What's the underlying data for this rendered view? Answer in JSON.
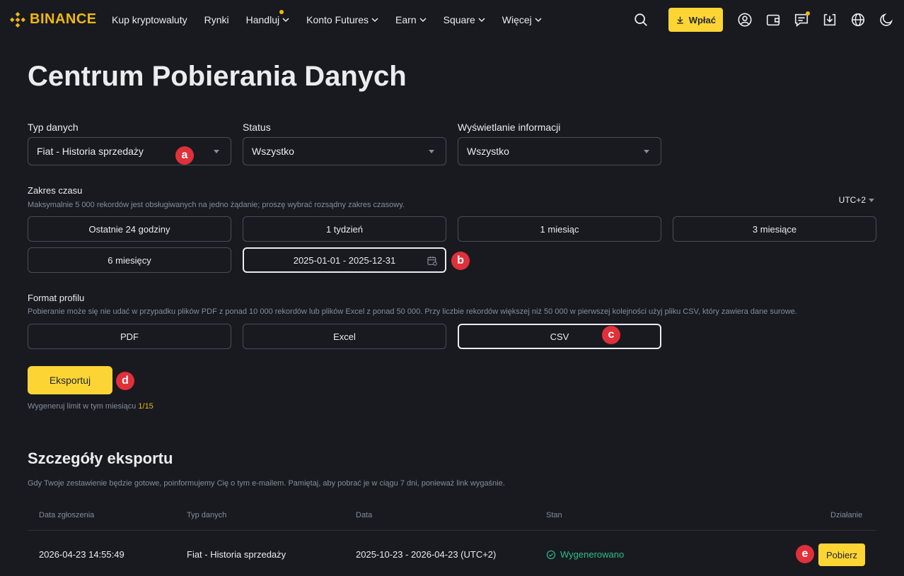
{
  "brand": {
    "name": "BINANCE",
    "color": "#f0b90b"
  },
  "nav": {
    "items": [
      {
        "label": "Kup kryptowaluty",
        "dropdown": false
      },
      {
        "label": "Rynki",
        "dropdown": false
      },
      {
        "label": "Handluj",
        "dropdown": true,
        "dot": true
      },
      {
        "label": "Konto Futures",
        "dropdown": true
      },
      {
        "label": "Earn",
        "dropdown": true
      },
      {
        "label": "Square",
        "dropdown": true
      },
      {
        "label": "Więcej",
        "dropdown": true
      }
    ],
    "deposit_label": "Wpłać",
    "icons": [
      "search-icon",
      "download-icon",
      "user-icon",
      "wallet-icon",
      "message-icon",
      "download-app-icon",
      "globe-icon",
      "moon-icon"
    ]
  },
  "page": {
    "title": "Centrum Pobierania Danych"
  },
  "filters": {
    "type": {
      "label": "Typ danych",
      "value": "Fiat - Historia sprzedaży"
    },
    "status": {
      "label": "Status",
      "value": "Wszystko"
    },
    "display": {
      "label": "Wyświetlanie informacji",
      "value": "Wszystko"
    }
  },
  "range": {
    "label": "Zakres czasu",
    "hint": "Maksymalnie 5 000 rekordów jest obsługiwanych na jedno żądanie; proszę wybrać rozsądny zakres czasowy.",
    "timezone": "UTC+2",
    "options": [
      "Ostatnie 24 godziny",
      "1 tydzień",
      "1 miesiąc",
      "3 miesiące",
      "6 miesięcy"
    ],
    "custom": "2025-01-01 - 2025-12-31"
  },
  "format": {
    "label": "Format profilu",
    "hint": "Pobieranie może się nie udać w przypadku plików PDF z ponad 10 000 rekordów lub plików Excel z ponad 50 000. Przy liczbie rekordów większej niż 50 000 w pierwszej kolejności użyj pliku CSV, który zawiera dane surowe.",
    "options": [
      "PDF",
      "Excel",
      "CSV"
    ],
    "selected": "CSV"
  },
  "export": {
    "button": "Eksportuj",
    "limit_text": "Wygeneruj limit w tym miesiącu",
    "limit_value": "1/15"
  },
  "details": {
    "title": "Szczegóły eksportu",
    "hint": "Gdy Twoje zestawienie będzie gotowe, poinformujemy Cię o tym e-mailem. Pamiętaj, aby pobrać je w ciągu 7 dni, ponieważ link wygaśnie.",
    "columns": [
      "Data zgłoszenia",
      "Typ danych",
      "Data",
      "Stan",
      "Działanie"
    ],
    "rows": [
      {
        "submitted": "2026-04-23 14:55:49",
        "type": "Fiat - Historia sprzedaży",
        "date": "2025-10-23 - 2026-04-23 (UTC+2)",
        "status": "Wygenerowano",
        "action": "Pobierz"
      }
    ]
  },
  "markers": {
    "a": "a",
    "b": "b",
    "c": "c",
    "d": "d",
    "e": "e"
  }
}
